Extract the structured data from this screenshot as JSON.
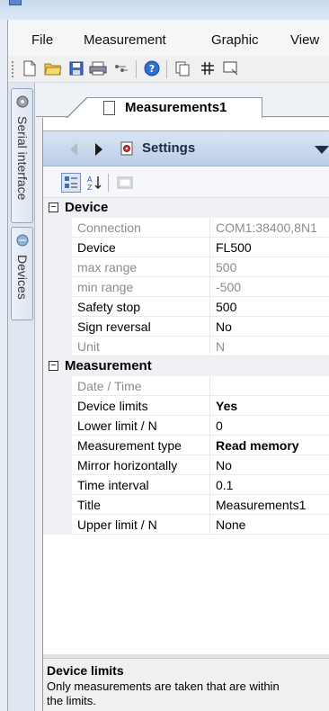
{
  "menu": {
    "items": [
      "File",
      "Measurement",
      "Graphic",
      "View"
    ]
  },
  "left_tabs": [
    {
      "label": "Serial interface"
    },
    {
      "label": "Devices"
    }
  ],
  "document_tab": {
    "title": "Measurements1"
  },
  "navigator": {
    "label": "Settings"
  },
  "property_grid": {
    "categories": [
      {
        "label": "Device",
        "expander": "−",
        "properties": [
          {
            "name": "Connection",
            "value": "COM1:38400,8N1",
            "readonly": true
          },
          {
            "name": "Device",
            "value": "FL500",
            "readonly": false
          },
          {
            "name": "max range",
            "value": "500",
            "readonly": true
          },
          {
            "name": "min range",
            "value": "-500",
            "readonly": true
          },
          {
            "name": "Safety stop",
            "value": "500",
            "readonly": false
          },
          {
            "name": "Sign reversal",
            "value": "No",
            "readonly": false
          },
          {
            "name": "Unit",
            "value": "N",
            "readonly": true
          }
        ]
      },
      {
        "label": "Measurement",
        "expander": "−",
        "properties": [
          {
            "name": "Date / Time",
            "value": "",
            "readonly": true
          },
          {
            "name": "Device limits",
            "value": "Yes",
            "readonly": false,
            "bold": true
          },
          {
            "name": "Lower limit / N",
            "value": "0",
            "readonly": false
          },
          {
            "name": "Measurement type",
            "value": "Read memory",
            "readonly": false,
            "bold": true
          },
          {
            "name": "Mirror horizontally",
            "value": "No",
            "readonly": false
          },
          {
            "name": "Time interval",
            "value": "0.1",
            "readonly": false
          },
          {
            "name": "Title",
            "value": "Measurements1",
            "readonly": false
          },
          {
            "name": "Upper limit / N",
            "value": "None",
            "readonly": false
          }
        ]
      }
    ]
  },
  "help": {
    "title": "Device limits",
    "description": "Only measurements are taken that are within the limits."
  },
  "colors": {
    "navbar": "#c9d8ec",
    "category_bg": "#eff1f4",
    "readonly_text": "#8c8c8c"
  }
}
